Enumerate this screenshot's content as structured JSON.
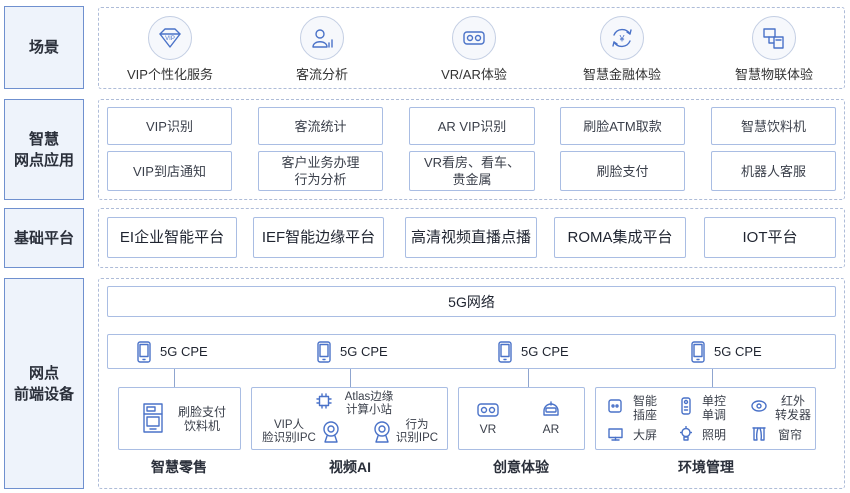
{
  "colors": {
    "accent": "#4a72c8",
    "label_border": "#6f90cf",
    "label_fill": "#eef3fb",
    "box_border": "#a9bde3",
    "dashed_border": "#aebcd8"
  },
  "layers": {
    "scene": {
      "label": "场景",
      "items": [
        {
          "icon": "vip-diamond-icon",
          "badge": "VIP",
          "label": "VIP个性化服务"
        },
        {
          "icon": "person-analytics-icon",
          "label": "客流分析"
        },
        {
          "icon": "vr-headset-icon",
          "label": "VR/AR体验"
        },
        {
          "icon": "yuan-exchange-icon",
          "badge": "¥",
          "label": "智慧金融体验"
        },
        {
          "icon": "iot-devices-icon",
          "label": "智慧物联体验"
        }
      ]
    },
    "apps": {
      "label": "智慧\n网点应用",
      "items": [
        "VIP识别",
        "客流统计",
        "AR VIP识别",
        "刷脸ATM取款",
        "智慧饮料机",
        "VIP到店通知",
        "客户业务办理\n行为分析",
        "VR看房、看车、\n贵金属",
        "刷脸支付",
        "机器人客服"
      ]
    },
    "platform": {
      "label": "基础平台",
      "items": [
        "EI企业智能平台",
        "IEF智能边缘平台",
        "高清视频直播点播",
        "ROMA集成平台",
        "IOT平台"
      ]
    },
    "devices": {
      "label": "网点\n前端设备",
      "network": "5G网络",
      "cpe": [
        "5G CPE",
        "5G CPE",
        "5G CPE",
        "5G CPE"
      ],
      "groups": [
        {
          "title": "智慧零售",
          "items": [
            {
              "icon": "drink-machine-icon",
              "label": "刷脸支付\n饮料机"
            }
          ]
        },
        {
          "title": "视频AI",
          "edge": {
            "icon": "chip-icon",
            "label": "Atlas边缘\n计算小站"
          },
          "cameras": [
            {
              "icon": "camera-icon",
              "label": "VIP人\n脸识别IPC"
            },
            {
              "icon": "camera-icon",
              "label": "行为\n识别IPC"
            }
          ]
        },
        {
          "title": "创意体验",
          "items": [
            {
              "icon": "vr-headset-icon",
              "label": "VR"
            },
            {
              "icon": "ar-helmet-icon",
              "label": "AR"
            }
          ]
        },
        {
          "title": "环境管理",
          "items": [
            {
              "icon": "smart-socket-icon",
              "label": "智能\n插座"
            },
            {
              "icon": "remote-control-icon",
              "label": "单控\n单调"
            },
            {
              "icon": "ir-transmitter-icon",
              "label": "红外\n转发器"
            },
            {
              "icon": "screen-icon",
              "label": "大屏"
            },
            {
              "icon": "light-bulb-icon",
              "label": "照明"
            },
            {
              "icon": "curtain-icon",
              "label": "窗帘"
            }
          ]
        }
      ]
    }
  }
}
